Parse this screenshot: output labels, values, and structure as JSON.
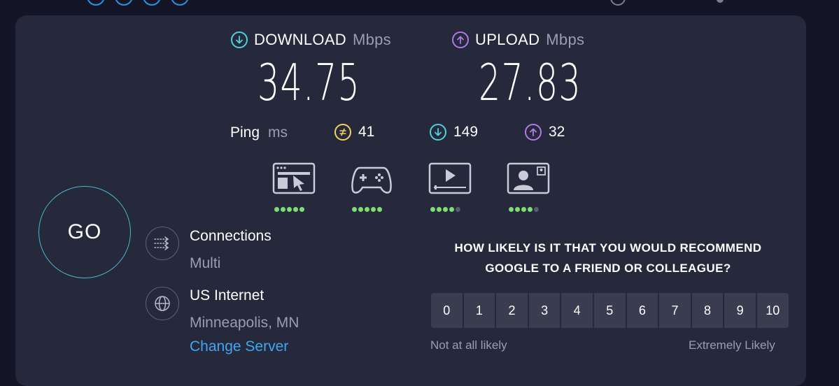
{
  "colors": {
    "background": "#141526",
    "panel": "#26283b",
    "download_accent": "#4fd1d9",
    "upload_accent": "#b07ae8",
    "ping_idle_accent": "#f2d35c",
    "quality_on": "#7be070",
    "quality_off": "#5a5d70",
    "link": "#3fa6f0"
  },
  "download": {
    "label": "DOWNLOAD",
    "unit": "Mbps",
    "value": "34.75",
    "icon": "arrow-down-circle-icon"
  },
  "upload": {
    "label": "UPLOAD",
    "unit": "Mbps",
    "value": "27.83",
    "icon": "arrow-up-circle-icon"
  },
  "ping": {
    "label": "Ping",
    "unit": "ms",
    "idle": "41",
    "download": "149",
    "upload": "32"
  },
  "quality": [
    {
      "icon": "web-browsing-icon",
      "score": 5,
      "max": 5
    },
    {
      "icon": "gaming-controller-icon",
      "score": 5,
      "max": 5
    },
    {
      "icon": "video-streaming-icon",
      "score": 4,
      "max": 5
    },
    {
      "icon": "video-chat-icon",
      "score": 4,
      "max": 5
    }
  ],
  "go_label": "GO",
  "connections": {
    "title": "Connections",
    "value": "Multi"
  },
  "server": {
    "provider": "US Internet",
    "location": "Minneapolis, MN",
    "change_label": "Change Server"
  },
  "survey": {
    "question_line1": "HOW LIKELY IS IT THAT YOU WOULD RECOMMEND",
    "question_line2": "GOOGLE TO A FRIEND OR COLLEAGUE?",
    "options": [
      "0",
      "1",
      "2",
      "3",
      "4",
      "5",
      "6",
      "7",
      "8",
      "9",
      "10"
    ],
    "low_label": "Not at all likely",
    "high_label": "Extremely Likely"
  }
}
